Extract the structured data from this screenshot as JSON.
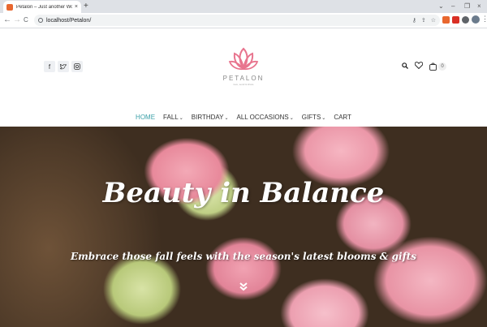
{
  "browser": {
    "tab_title": "Petalon – Just another WordPre",
    "tab_close": "×",
    "new_tab": "+",
    "url": "localhost/Petalon/",
    "minimize": "–",
    "maximize": "❐",
    "close_window": "×",
    "tabs_dropdown": "⌄",
    "back": "←",
    "forward": "→",
    "reload": "C",
    "menu": "⋮"
  },
  "site": {
    "brand": "PETALON",
    "tagline": "love, send & share",
    "menu": [
      {
        "label": "HOME",
        "active": true,
        "has_dropdown": false
      },
      {
        "label": "FALL",
        "active": false,
        "has_dropdown": true
      },
      {
        "label": "BIRTHDAY",
        "active": false,
        "has_dropdown": true
      },
      {
        "label": "ALL OCCASIONS",
        "active": false,
        "has_dropdown": true
      },
      {
        "label": "GIFTS",
        "active": false,
        "has_dropdown": true
      },
      {
        "label": "CART",
        "active": false,
        "has_dropdown": false
      }
    ],
    "cart_count": "0",
    "social": [
      {
        "icon": "facebook-icon",
        "glyph": "f"
      },
      {
        "icon": "twitter-icon",
        "glyph": "t"
      },
      {
        "icon": "instagram-icon",
        "glyph": "◎"
      }
    ]
  },
  "hero": {
    "title": "Beauty in Balance",
    "subtitle": "Embrace those fall feels with the season's latest blooms & gifts",
    "scroll_glyph": "⌄⌄"
  },
  "colors": {
    "accent": "#3ba0a8",
    "logo_pink": "#e8748e"
  }
}
